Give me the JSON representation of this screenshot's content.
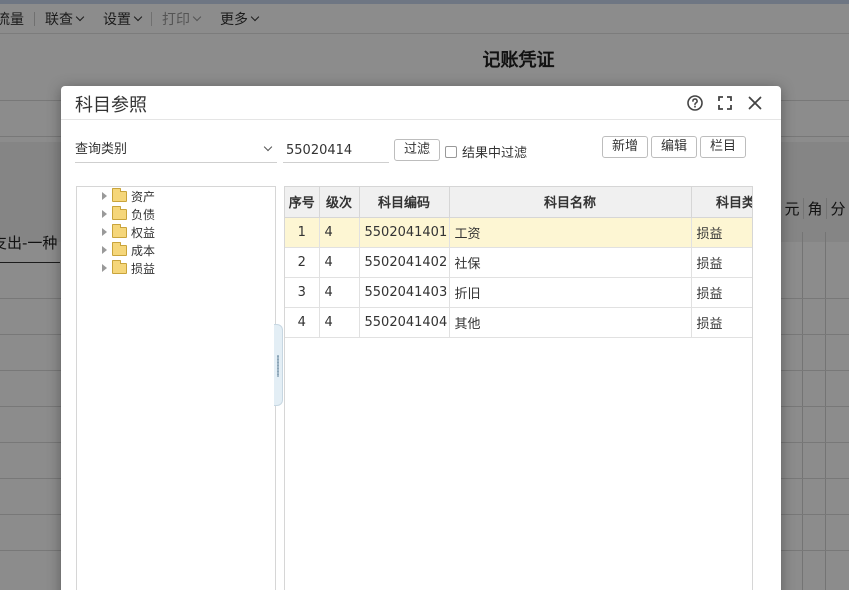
{
  "toolbar": {
    "items": [
      {
        "label": "流量",
        "has_menu": false
      },
      {
        "label": "联查",
        "has_menu": true
      },
      {
        "label": "设置",
        "has_menu": true
      },
      {
        "label": "打印",
        "has_menu": true,
        "disabled": true
      },
      {
        "label": "更多",
        "has_menu": true
      }
    ]
  },
  "background": {
    "title": "记账凭证",
    "summary_text": "支出-一种",
    "amount_digits": [
      "元",
      "角",
      "分"
    ]
  },
  "dialog": {
    "title": "科目参照",
    "query_type": "查询类别",
    "filter_value": "55020414",
    "filter_button": "过滤",
    "filter_in_result": "结果中过滤",
    "add_button": "新增",
    "edit_button": "编辑",
    "column_button": "栏目",
    "tree": [
      "资产",
      "负债",
      "权益",
      "成本",
      "损益"
    ],
    "table": {
      "headers": [
        "序号",
        "级次",
        "科目编码",
        "科目名称",
        "科目类型"
      ],
      "rows": [
        [
          "1",
          "4",
          "5502041401",
          "工资",
          "损益"
        ],
        [
          "2",
          "4",
          "5502041402",
          "社保",
          "损益"
        ],
        [
          "3",
          "4",
          "5502041403",
          "折旧",
          "损益"
        ],
        [
          "4",
          "4",
          "5502041404",
          "其他",
          "损益"
        ]
      ],
      "selected_row": 0
    }
  },
  "colors": {
    "overlay": "#000000",
    "selected_row": "#fdf6d3",
    "folder": "#f5d67a"
  }
}
